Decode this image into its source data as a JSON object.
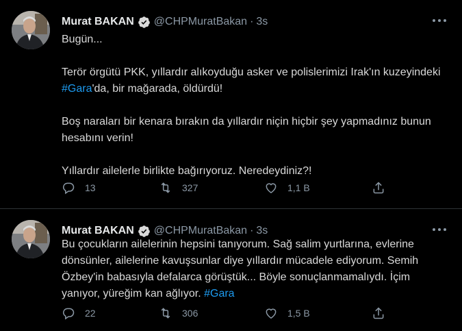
{
  "tweets": [
    {
      "author_name": "Murat BAKAN",
      "handle": "@CHPMuratBakan",
      "separator": "·",
      "time": "3s",
      "line1": "Bugün...",
      "p2_pre": "Terör örgütü PKK, yıllardır alıkoyduğu asker ve polislerimizi Irak'ın kuzeyindeki ",
      "p2_hashtag": "#Gara",
      "p2_post": "'da, bir mağarada, öldürdü!",
      "p3": "Boş naraları bir kenara bırakın da yıllardır niçin hiçbir şey yapmadınız bunun hesabını verin!",
      "p4": "Yıllardır ailelerle birlikte bağırıyoruz. Neredeydiniz?!",
      "replies": "13",
      "retweets": "327",
      "likes": "1,1 B"
    },
    {
      "author_name": "Murat BAKAN",
      "handle": "@CHPMuratBakan",
      "separator": "·",
      "time": "3s",
      "text_pre": "Bu çocukların ailelerinin hepsini tanıyorum. Sağ salim yurtlarına, evlerine dönsünler, ailelerine kavuşsunlar diye yıllardır mücadele ediyorum. Semih Özbey'in babasıyla defalarca görüştük... Böyle sonuçlanmamalıydı. İçim yanıyor, yüreğim kan ağlıyor. ",
      "text_hashtag": "#Gara",
      "replies": "22",
      "retweets": "306",
      "likes": "1,5 B"
    }
  ],
  "icons": {
    "verified": "verified-badge-icon",
    "more": "more-options-icon",
    "reply": "reply-icon",
    "retweet": "retweet-icon",
    "like": "like-icon",
    "share": "share-icon"
  },
  "colors": {
    "background": "#000000",
    "text": "#d9d9d9",
    "secondary": "#8b98a5",
    "accent": "#1d9bf0",
    "divider": "#2f3336"
  }
}
